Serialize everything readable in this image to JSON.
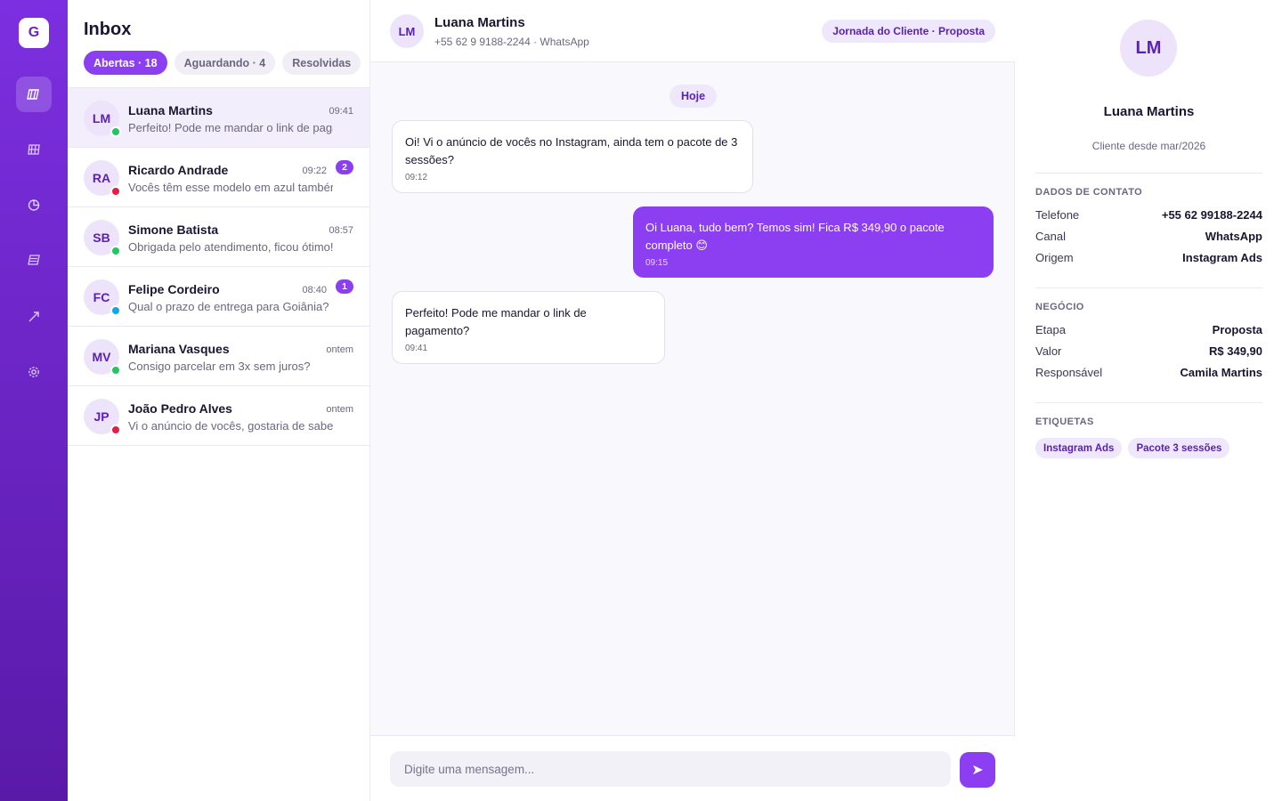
{
  "rail": {
    "logo": "G",
    "items": [
      {
        "icon": "columns-icon",
        "active": true
      },
      {
        "icon": "grid-icon",
        "active": false
      },
      {
        "icon": "pie-icon",
        "active": false
      },
      {
        "icon": "book-icon",
        "active": false
      },
      {
        "icon": "trend-icon",
        "active": false
      },
      {
        "icon": "gear-icon",
        "active": false
      }
    ]
  },
  "inbox": {
    "title": "Inbox",
    "filters": [
      "Abertas · 18",
      "Aguardando · 4",
      "Resolvidas"
    ],
    "conversations": [
      {
        "initials": "LM",
        "name": "Luana Martins",
        "time": "09:41",
        "preview": "Perfeito! Pode me mandar o link de pagamento?",
        "badge": "",
        "status_color": "#22c55e"
      },
      {
        "initials": "RA",
        "name": "Ricardo Andrade",
        "time": "09:22",
        "preview": "Vocês têm esse modelo em azul também?",
        "badge": "2",
        "status_color": "#e11d48"
      },
      {
        "initials": "SB",
        "name": "Simone Batista",
        "time": "08:57",
        "preview": "Obrigada pelo atendimento, ficou ótimo!",
        "badge": "",
        "status_color": "#22c55e"
      },
      {
        "initials": "FC",
        "name": "Felipe Cordeiro",
        "time": "08:40",
        "preview": "Qual o prazo de entrega para Goiânia?",
        "badge": "1",
        "status_color": "#0ea5e9"
      },
      {
        "initials": "MV",
        "name": "Mariana Vasques",
        "time": "ontem",
        "preview": "Consigo parcelar em 3x sem juros?",
        "badge": "",
        "status_color": "#22c55e"
      },
      {
        "initials": "JP",
        "name": "João Pedro Alves",
        "time": "ontem",
        "preview": "Vi o anúncio de vocês, gostaria de saber mais",
        "badge": "",
        "status_color": "#e11d48"
      }
    ]
  },
  "chat": {
    "initials": "LM",
    "name": "Luana Martins",
    "subtitle": "+55 62 9 9188-2244 · WhatsApp",
    "journey": "Jornada do Cliente · Proposta",
    "day": "Hoje",
    "messages": [
      {
        "text": "Oi! Vi o anúncio de vocês no Instagram, ainda tem o pacote de 3 sessões?",
        "time": "09:12"
      },
      {
        "text": "Oi Luana, tudo bem? Temos sim! Fica R$ 349,90 o pacote completo 😊",
        "time": "09:15"
      },
      {
        "text": "Perfeito! Pode me mandar o link de pagamento?",
        "time": "09:41"
      }
    ],
    "composer_placeholder": "Digite uma mensagem...",
    "send_glyph": "➤"
  },
  "panel": {
    "initials": "LM",
    "name": "Luana Martins",
    "since": "Cliente desde mar/2026",
    "contact_title": "DADOS DE CONTATO",
    "contact": [
      {
        "k": "Telefone",
        "v": "+55 62 99188-2244"
      },
      {
        "k": "Canal",
        "v": "WhatsApp"
      },
      {
        "k": "Origem",
        "v": "Instagram Ads"
      }
    ],
    "deal_title": "NEGÓCIO",
    "deal": [
      {
        "k": "Etapa",
        "v": "Proposta"
      },
      {
        "k": "Valor",
        "v": "R$ 349,90"
      },
      {
        "k": "Responsável",
        "v": "Camila Martins"
      }
    ],
    "tags_title": "ETIQUETAS",
    "tags": [
      "Instagram Ads",
      "Pacote 3 sessões"
    ]
  },
  "colors": {
    "accent": "#8b3ff0",
    "accent_dark": "#5b21b6",
    "rail_top": "#7c2fe0",
    "rail_bottom": "#5a1aa8"
  }
}
